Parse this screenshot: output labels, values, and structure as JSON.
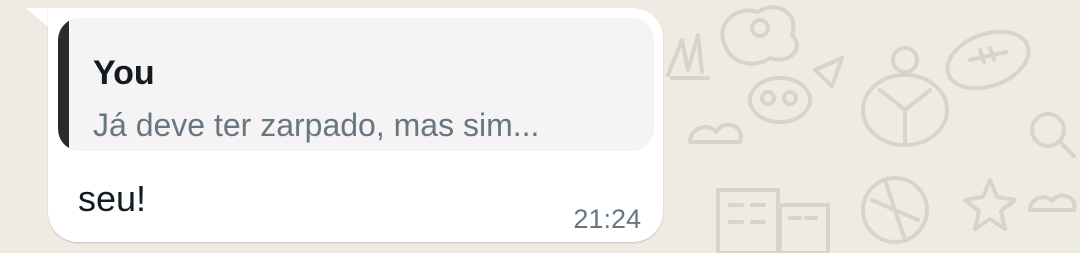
{
  "colors": {
    "wallpaper": "#efeae2",
    "bubble": "#ffffff",
    "quote_background": "#f5f3f3",
    "quote_bar": "#2b2b2b",
    "primary_text": "#111b21",
    "secondary_text": "#667781"
  },
  "message": {
    "quote": {
      "author": "You",
      "text": "Já deve ter zarpado, mas sim..."
    },
    "text": "seu!",
    "time": "21:24"
  }
}
